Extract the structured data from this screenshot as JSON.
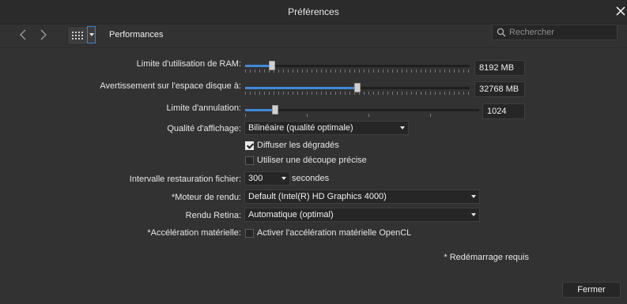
{
  "window": {
    "title": "Préférences"
  },
  "toolbar": {
    "section": "Performances",
    "search_placeholder": "Rechercher"
  },
  "ram": {
    "label": "Limite d'utilisation de RAM:",
    "value": "8192 MB",
    "fraction": 0.12
  },
  "disk": {
    "label": "Avertissement sur l'espace disque à:",
    "value": "32768 MB",
    "fraction": 0.5
  },
  "undo": {
    "label": "Limite d'annulation:",
    "value": "1024",
    "fraction": 0.13
  },
  "quality": {
    "label": "Qualité d'affichage:",
    "selected": "Bilinéaire (qualité optimale)"
  },
  "dither": {
    "label": "Diffuser les dégradés",
    "checked": true
  },
  "precise_clip": {
    "label": "Utiliser une découpe précise",
    "checked": false
  },
  "autosave": {
    "label": "Intervalle restauration fichier:",
    "value": "300",
    "unit": "secondes"
  },
  "render_engine": {
    "label": "*Moteur de rendu:",
    "selected": "Default (Intel(R) HD Graphics 4000)"
  },
  "retina": {
    "label": "Rendu Retina:",
    "selected": "Automatique (optimal)"
  },
  "hw_accel": {
    "label": "*Accélération matérielle:",
    "checkbox_label": "Activer l'accélération matérielle OpenCL",
    "checked": false
  },
  "footer": {
    "restart_note": "* Redémarrage requis",
    "close_label": "Fermer"
  },
  "colors": {
    "accent": "#3d8ad6",
    "background": "#323232",
    "field": "#262626"
  }
}
